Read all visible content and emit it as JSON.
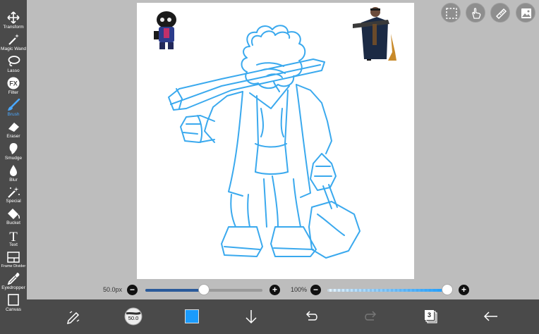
{
  "tools": [
    {
      "label": "Transform",
      "icon": "transform-icon"
    },
    {
      "label": "Magic Wand",
      "icon": "magic-wand-icon"
    },
    {
      "label": "Lasso",
      "icon": "lasso-icon"
    },
    {
      "label": "Filter",
      "icon": "fx-icon",
      "glyph": "FX"
    },
    {
      "label": "Brush",
      "icon": "brush-icon"
    },
    {
      "label": "Eraser",
      "icon": "eraser-icon"
    },
    {
      "label": "Smudge",
      "icon": "smudge-icon"
    },
    {
      "label": "Blur",
      "icon": "blur-drop-icon"
    },
    {
      "label": "Special",
      "icon": "special-wand-icon"
    },
    {
      "label": "Bucket",
      "icon": "bucket-icon"
    },
    {
      "label": "Text",
      "icon": "text-icon",
      "glyph": "T"
    },
    {
      "label": "Frame Divider",
      "icon": "frame-divider-icon"
    },
    {
      "label": "Eyedropper",
      "icon": "eyedropper-icon"
    },
    {
      "label": "Canvas",
      "icon": "canvas-icon"
    }
  ],
  "active_tool": "Brush",
  "sliders": {
    "size_label": "50.0px",
    "size_value": 0.5,
    "opacity_label": "100%",
    "opacity_value": 1.0,
    "minus": "−",
    "plus": "+"
  },
  "bottom": {
    "brush_size_badge": "50.0",
    "current_color": "#1a9bfc",
    "layer_count": "3"
  },
  "colors": {
    "sketch": "#3aa9ee",
    "accent": "#1a9bfc",
    "toolbar": "#4a4a4a"
  }
}
